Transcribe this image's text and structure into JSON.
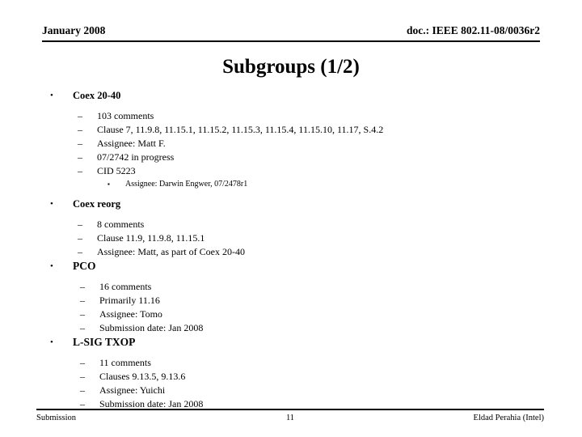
{
  "header": {
    "date": "January 2008",
    "doc": "doc.: IEEE 802.11-08/0036r2"
  },
  "title": "Subgroups (1/2)",
  "markers": {
    "level1": "•",
    "level2": "–",
    "level3": "▪"
  },
  "sections": [
    {
      "heading": "Coex 20-40",
      "items": [
        "103 comments",
        "Clause 7, 11.9.8, 11.15.1, 11.15.2, 11.15.3, 11.15.4, 11.15.10, 11.17, S.4.2",
        "Assignee: Matt F.",
        "07/2742 in progress",
        "CID 5223"
      ],
      "subitems": [
        "Assignee: Darwin Engwer, 07/2478r1"
      ]
    },
    {
      "heading": "Coex reorg",
      "items": [
        "8 comments",
        "Clause 11.9, 11.9.8, 11.15.1",
        "Assignee: Matt, as part of Coex 20-40"
      ]
    },
    {
      "heading": "PCO",
      "items": [
        "16 comments",
        "Primarily 11.16",
        "Assignee: Tomo",
        "Submission date: Jan 2008"
      ]
    },
    {
      "heading": "L-SIG TXOP",
      "items": [
        "11 comments",
        "Clauses 9.13.5, 9.13.6",
        "Assignee: Yuichi",
        "Submission date: Jan 2008"
      ]
    }
  ],
  "footer": {
    "left": "Submission",
    "page": "11",
    "right": "Eldad Perahia (Intel)"
  }
}
